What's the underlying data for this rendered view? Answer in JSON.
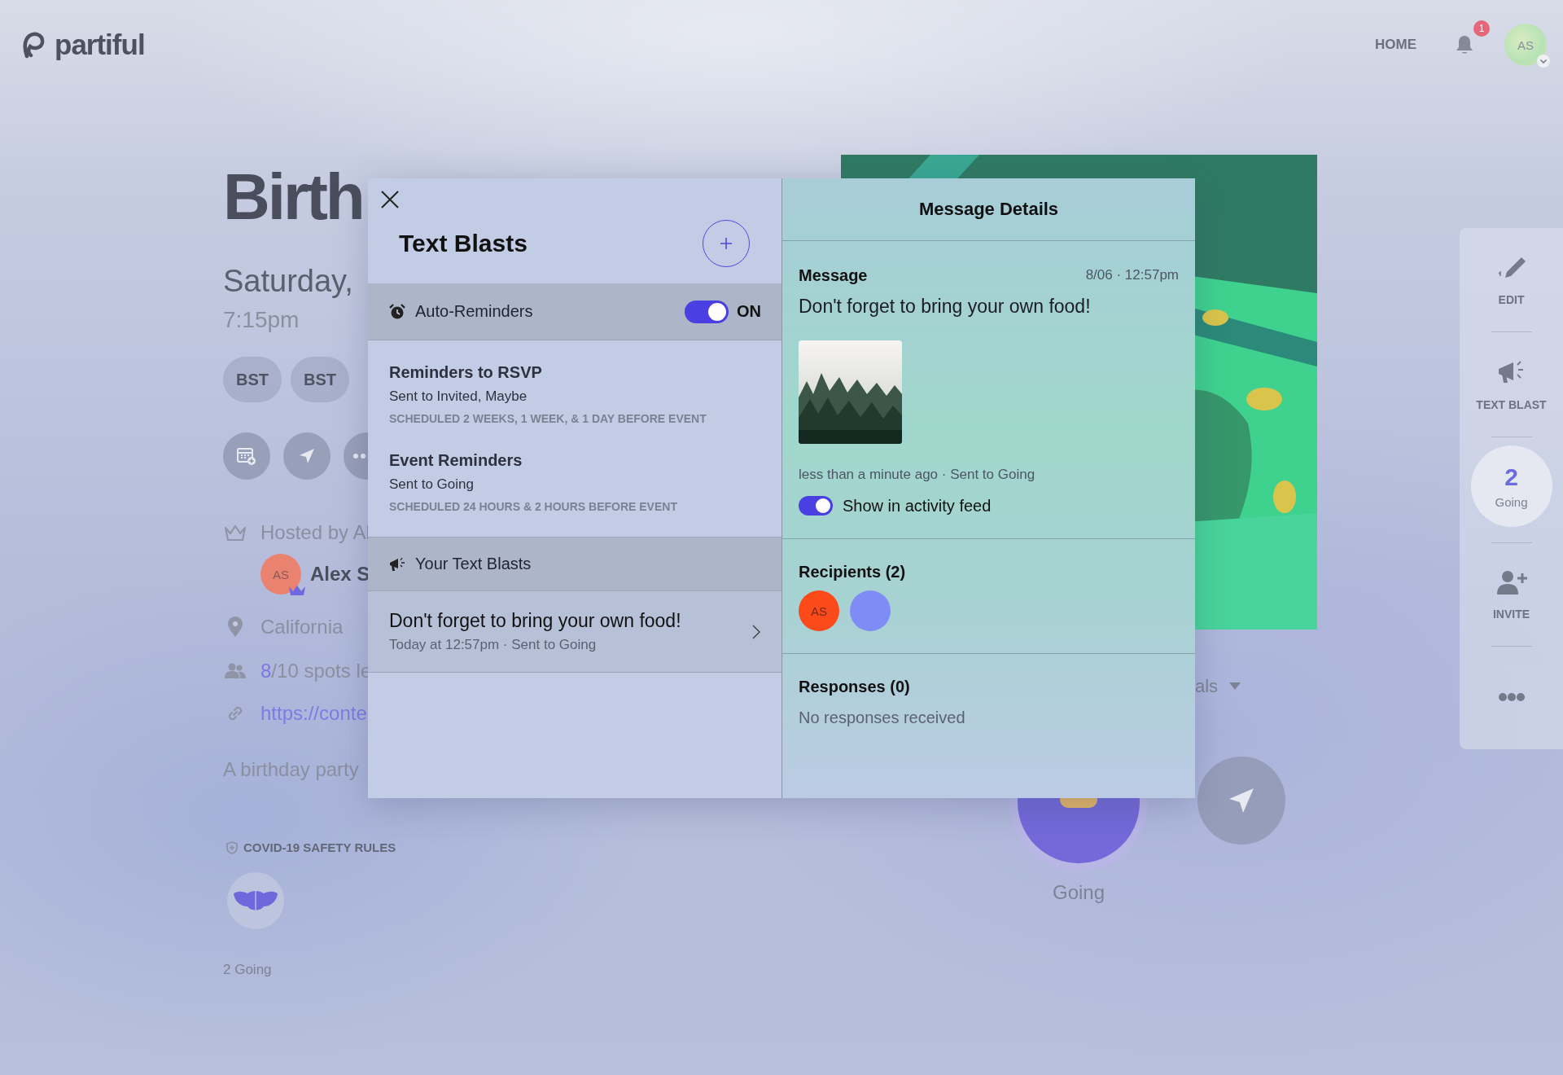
{
  "header": {
    "logo": "partiful",
    "nav": [
      {
        "label": "HOME"
      }
    ],
    "notification_count": "1",
    "avatar": "AS"
  },
  "event": {
    "title": "Birth",
    "date": "Saturday,",
    "time": "7:15pm",
    "timezones": [
      "BST",
      "BST"
    ],
    "host_label": "Hosted by Al",
    "host": {
      "initials": "AS",
      "name": "Alex S"
    },
    "location": "California",
    "spots": {
      "taken": "8",
      "rest": "/10 spots le"
    },
    "link": "https://conte",
    "description": "A birthday party",
    "safety_title": "COVID-19 SAFETY RULES",
    "going_count": "2 Going",
    "details_toggle": "als",
    "rsvp_label": "Going"
  },
  "sidebar": {
    "edit": "EDIT",
    "text_blast": "TEXT BLAST",
    "going": {
      "count": "2",
      "label": "Going"
    },
    "invite": "INVITE"
  },
  "modal": {
    "title": "Text Blasts",
    "auto_reminders": {
      "label": "Auto-Reminders",
      "on": true,
      "state_label": "ON"
    },
    "reminders": [
      {
        "title": "Reminders to RSVP",
        "audience": "Sent to Invited, Maybe",
        "schedule": "SCHEDULED 2 WEEKS, 1 WEEK, & 1 DAY BEFORE EVENT"
      },
      {
        "title": "Event Reminders",
        "audience": "Sent to Going",
        "schedule": "SCHEDULED 24 HOURS & 2 HOURS BEFORE EVENT"
      }
    ],
    "blasts_title": "Your Text Blasts",
    "blasts": [
      {
        "text": "Don't forget to bring your own food!",
        "meta": "Today at 12:57pm · Sent to Going",
        "selected": true
      }
    ],
    "details": {
      "title": "Message Details",
      "message_label": "Message",
      "date": "8/06 · 12:57pm",
      "text": "Don't forget to bring your own food!",
      "meta": "less than a minute ago · Sent to Going",
      "activity_feed": {
        "label": "Show in activity feed",
        "on": true
      },
      "recipients_title": "Recipients (2)",
      "recipients": [
        {
          "initials": "AS",
          "color": "#fc4a1a"
        },
        {
          "color": "#7f8cf5"
        }
      ],
      "responses_title": "Responses (0)",
      "responses_empty": "No responses received"
    }
  }
}
